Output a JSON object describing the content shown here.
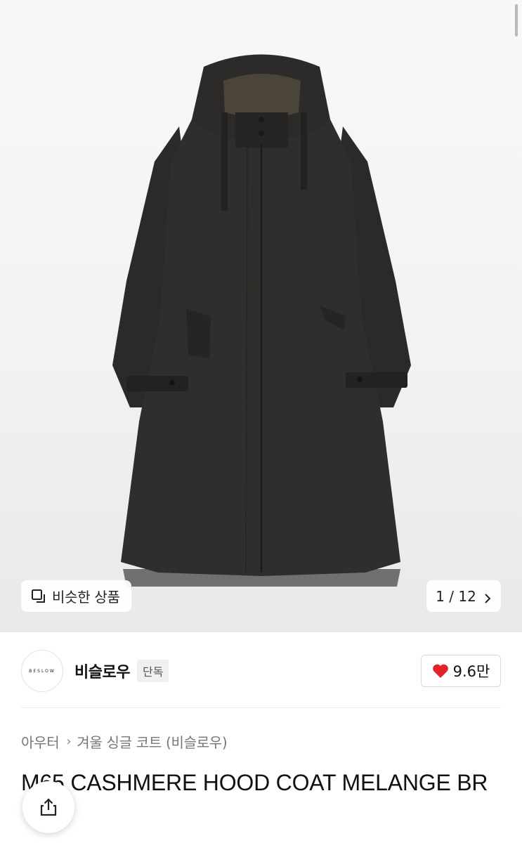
{
  "gallery": {
    "similar_label": "비슷한 상품",
    "current": "1",
    "total": "12",
    "pager_label": "1 / 12"
  },
  "brand": {
    "logo_text": "BESLOW",
    "name": "비슬로우",
    "badge": "단독",
    "likes": "9.6만"
  },
  "breadcrumb": {
    "items": [
      "아우터",
      "겨울 싱글 코트 (비슬로우)"
    ]
  },
  "product": {
    "title": "M65 CASHMERE HOOD COAT MELANGE BR"
  },
  "colors": {
    "coat": "#2f2d2b",
    "heart": "#e8202a",
    "background": "#f2f2f2"
  },
  "icons": {
    "similar": "similar-items-icon",
    "pager_next": "chevron-right-icon",
    "like": "heart-icon",
    "share": "share-icon"
  }
}
